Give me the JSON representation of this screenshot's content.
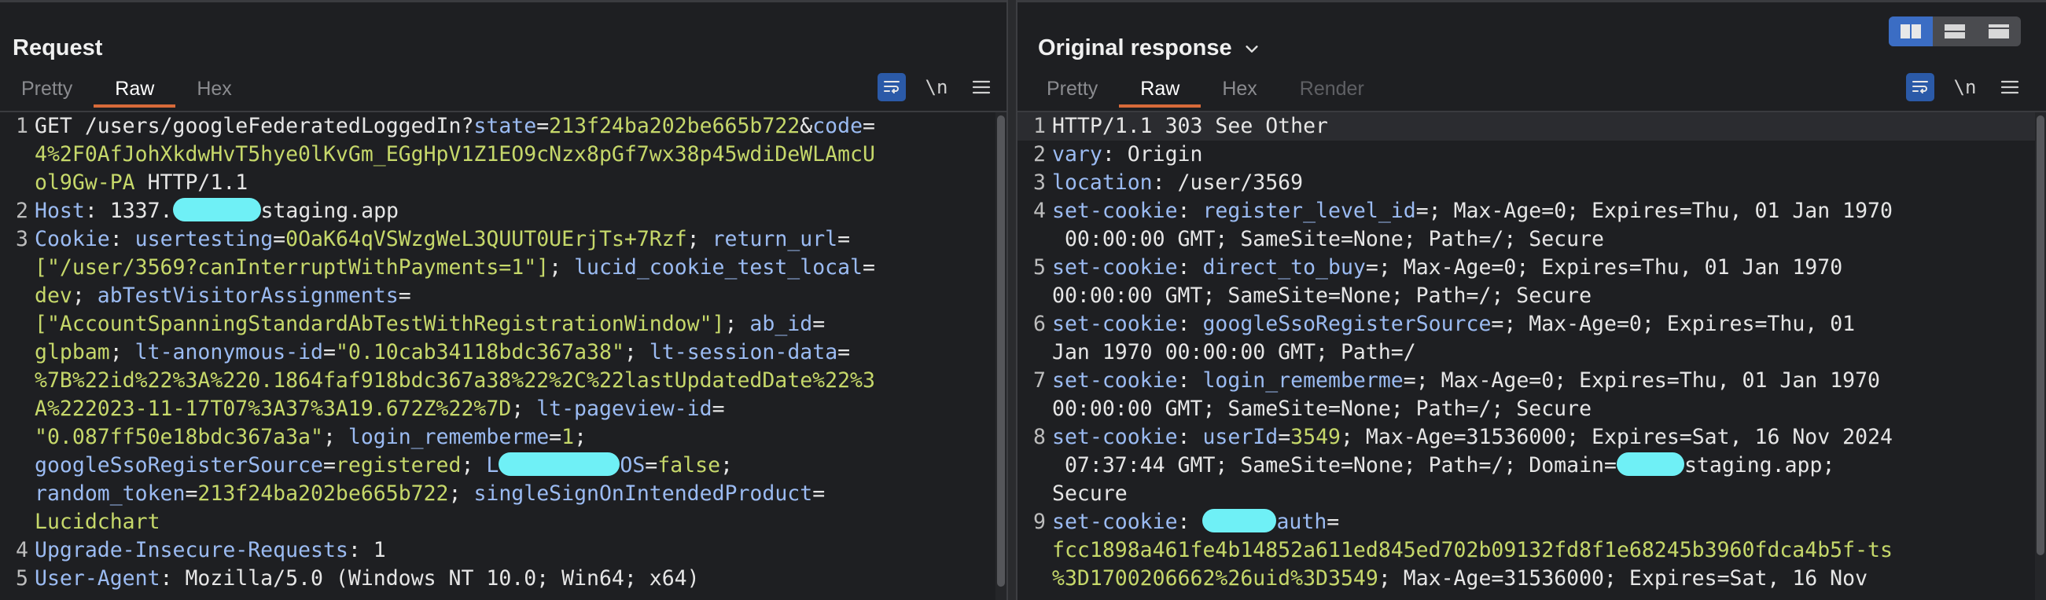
{
  "request": {
    "title": "Request",
    "tabs": [
      "Pretty",
      "Raw",
      "Hex"
    ],
    "active_tab": "Raw",
    "newline_label": "\\n",
    "menu_label": "≡",
    "lines": {
      "1a": {
        "n": "1",
        "t1": "GET /users/googleFederatedLoggedIn?",
        "k1": "state",
        "e1": "=",
        "v1": "213f24ba202be665b722",
        "a1": "&",
        "k2": "code",
        "e2": "="
      },
      "1b": {
        "v": "4%2F0AfJohXkdwHvT5hye0lKvGm_EGgHpV1Z1EO9cNzx8pGf7wx38p45wdiDeWLAmcU"
      },
      "1c": {
        "v": "ol9Gw-PA",
        "t": " HTTP/1.1"
      },
      "2": {
        "n": "2",
        "k": "Host",
        "t1": ": 1337.",
        "t2": "staging.app"
      },
      "3a": {
        "n": "3",
        "k": "Cookie",
        "t": ": ",
        "k1": "usertesting",
        "e1": "=",
        "v1": "0OaK64qVSWzgWeL3QUUT0UErjTs+7Rzf",
        "s1": "; ",
        "k2": "return_url",
        "e2": "="
      },
      "3b": {
        "v": "[\"/user/3569?canInterruptWithPayments=1\"]",
        "s": "; ",
        "k": "lucid_cookie_test_local",
        "e": "="
      },
      "3c": {
        "v": "dev",
        "s": "; ",
        "k": "abTestVisitorAssignments",
        "e": "="
      },
      "3d": {
        "v": "[\"AccountSpanningStandardAbTestWithRegistrationWindow\"]",
        "s": "; ",
        "k": "ab_id",
        "e": "="
      },
      "3e": {
        "v1": "glpbam",
        "s1": "; ",
        "k1": "lt-anonymous-id",
        "e1": "=",
        "v2": "\"0.10cab34118bdc367a38\"",
        "s2": "; ",
        "k2": "lt-session-data",
        "e2": "="
      },
      "3f": {
        "v": "%7B%22id%22%3A%220.1864faf918bdc367a38%22%2C%22lastUpdatedDate%22%3"
      },
      "3g": {
        "v": "A%222023-11-17T07%3A37%3A19.672Z%22%7D",
        "s": "; ",
        "k": "lt-pageview-id",
        "e": "="
      },
      "3h": {
        "v1": "\"0.087ff50e18bdc367a3a\"",
        "s1": "; ",
        "k1": "login_rememberme",
        "e1": "=",
        "v2": "1",
        "s2": ";"
      },
      "3i": {
        "k1": "googleSsoRegisterSource",
        "e1": "=",
        "v1": "registered",
        "s1": "; ",
        "k2a": "L",
        "k2b": "OS",
        "e2": "=",
        "v2": "false",
        "s2": ";"
      },
      "3j": {
        "k1": "random_token",
        "e1": "=",
        "v1": "213f24ba202be665b722",
        "s1": "; ",
        "k2": "singleSignOnIntendedProduct",
        "e2": "="
      },
      "3k": {
        "v": "Lucidchart"
      },
      "4": {
        "n": "4",
        "k": "Upgrade-Insecure-Requests",
        "t": ": 1"
      },
      "5": {
        "n": "5",
        "k": "User-Agent",
        "t": ": Mozilla/5.0 (Windows NT 10.0; Win64; x64)"
      }
    }
  },
  "response": {
    "title": "Original response",
    "tabs": [
      "Pretty",
      "Raw",
      "Hex",
      "Render"
    ],
    "active_tab": "Raw",
    "newline_label": "\\n",
    "menu_label": "≡",
    "lines": {
      "1": {
        "n": "1",
        "t": "HTTP/1.1 303 See Other"
      },
      "2": {
        "n": "2",
        "k": "vary",
        "t": ": Origin"
      },
      "3": {
        "n": "3",
        "k": "location",
        "t": ": /user/3569"
      },
      "4a": {
        "n": "4",
        "k": "set-cookie",
        "s": ": ",
        "k1": "register_level_id",
        "t": "=; Max-Age=0; Expires=Thu, 01 Jan 1970"
      },
      "4b": {
        "t": " 00:00:00 GMT; SameSite=None; Path=/; Secure"
      },
      "5a": {
        "n": "5",
        "k": "set-cookie",
        "s": ": ",
        "k1": "direct_to_buy",
        "t": "=; Max-Age=0; Expires=Thu, 01 Jan 1970"
      },
      "5b": {
        "t": "00:00:00 GMT; SameSite=None; Path=/; Secure"
      },
      "6a": {
        "n": "6",
        "k": "set-cookie",
        "s": ": ",
        "k1": "googleSsoRegisterSource",
        "t": "=; Max-Age=0; Expires=Thu, 01"
      },
      "6b": {
        "t": "Jan 1970 00:00:00 GMT; Path=/"
      },
      "7a": {
        "n": "7",
        "k": "set-cookie",
        "s": ": ",
        "k1": "login_rememberme",
        "t": "=; Max-Age=0; Expires=Thu, 01 Jan 1970"
      },
      "7b": {
        "t": "00:00:00 GMT; SameSite=None; Path=/; Secure"
      },
      "8a": {
        "n": "8",
        "k": "set-cookie",
        "s": ": ",
        "k1": "userId",
        "e": "=",
        "v": "3549",
        "t": "; Max-Age=31536000; Expires=Sat, 16 Nov 2024"
      },
      "8b": {
        "t1": " 07:37:44 GMT; SameSite=None; Path=/; Domain=",
        "t2": "staging.app;"
      },
      "8c": {
        "t": "Secure"
      },
      "9a": {
        "n": "9",
        "k": "set-cookie",
        "s": ": ",
        "k1": "auth",
        "e": "="
      },
      "9b": {
        "v": "fcc1898a461fe4b14852a611ed845ed702b09132fd8f1e68245b3960fdca4b5f-ts"
      },
      "9c": {
        "v": "%3D1700206662%26uid%3D3549",
        "t": "; Max-Age=31536000; Expires=Sat, 16 Nov"
      }
    }
  }
}
